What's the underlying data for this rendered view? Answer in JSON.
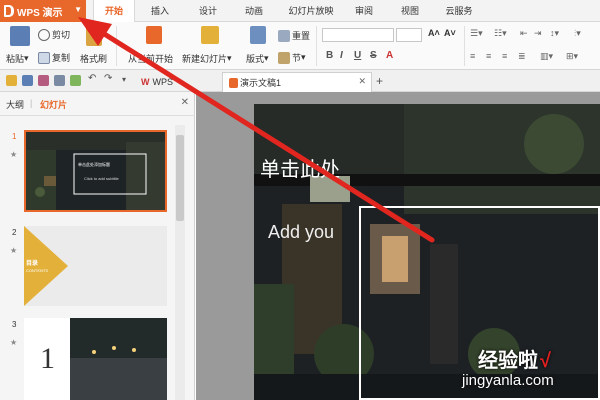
{
  "app": {
    "title": "WPS 演示"
  },
  "menu": {
    "tabs": [
      "开始",
      "插入",
      "设计",
      "动画",
      "幻灯片放映",
      "审阅",
      "视图",
      "云服务"
    ]
  },
  "ribbon": {
    "paste": "粘贴",
    "cut": "剪切",
    "copy": "复制",
    "format_painter": "格式刷",
    "play_from_start": "从当前开始",
    "new_slide": "新建幻灯片",
    "layout": "版式",
    "section": "节",
    "reset": "重置",
    "font_buttons": [
      "B",
      "I",
      "U",
      "S",
      "A"
    ]
  },
  "doc_tabs": [
    {
      "label": "WPS"
    },
    {
      "label": "演示文稿1"
    }
  ],
  "panel": {
    "tabs": [
      "大纲",
      "幻灯片"
    ]
  },
  "thumbnails": [
    {
      "num": "1",
      "title": "单击此处添加标题",
      "sub": "Click to add subtitle"
    },
    {
      "num": "2",
      "title": "目录",
      "sub": "CONTENTS"
    },
    {
      "num": "3",
      "big": "1"
    }
  ],
  "slide": {
    "title": "单击此处",
    "subtitle": "Add you"
  },
  "watermark": {
    "title": "经验啦",
    "check": "√",
    "url": "jingyanla.com"
  },
  "colors": {
    "accent": "#e8672a",
    "menubar": "#f3f3f3",
    "ribbon": "#fafafa",
    "arrow": "#e0261e",
    "gold": "#e3b13a"
  }
}
